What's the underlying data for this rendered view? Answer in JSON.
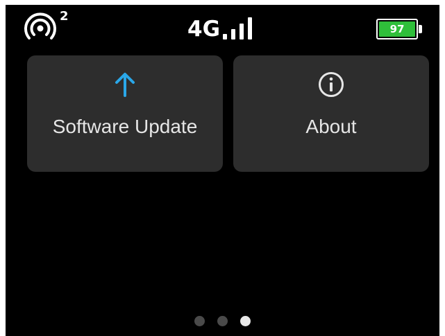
{
  "status_bar": {
    "hotspot_icon": "wifi-hotspot-icon",
    "connected_devices": "2",
    "network_type": "4G",
    "signal_icon": "signal-bars-icon",
    "signal_level": 4,
    "battery_percent": "97",
    "battery_color": "#2fbf3a"
  },
  "tiles": [
    {
      "label": "Software Update",
      "icon": "arrow-up-icon",
      "icon_color": "#2aa7e8"
    },
    {
      "label": "About",
      "icon": "info-icon",
      "icon_color": "#e6e6e6"
    }
  ],
  "pager": {
    "count": 3,
    "active_index": 2
  },
  "colors": {
    "background": "#000000",
    "tile_background": "#2d2d2d",
    "text": "#e6e6e6",
    "accent": "#2aa7e8"
  }
}
